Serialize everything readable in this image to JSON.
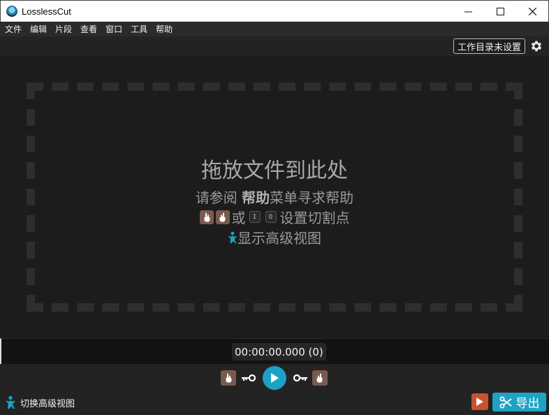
{
  "window": {
    "title": "LosslessCut",
    "controls": {
      "minimize": "minimize-icon",
      "maximize": "maximize-icon",
      "close": "close-icon"
    }
  },
  "menu": {
    "items": [
      {
        "label": "文件"
      },
      {
        "label": "编辑"
      },
      {
        "label": "片段"
      },
      {
        "label": "查看"
      },
      {
        "label": "窗口"
      },
      {
        "label": "工具"
      },
      {
        "label": "帮助"
      }
    ]
  },
  "toolbar": {
    "workdir_label": "工作目录未设置",
    "settings_icon": "gear-icon"
  },
  "dropzone": {
    "title": "拖放文件到此处",
    "help_prefix": "请参阅 ",
    "help_bold": "帮助",
    "help_suffix": "菜单寻求帮助",
    "cut_or": "或",
    "key_in": "I",
    "key_out": "O",
    "cut_suffix": "设置切割点",
    "advanced_view": "显示高级视图"
  },
  "timeline": {
    "timecode": "00:00:00.000 (0)"
  },
  "controls": {
    "advanced_toggle": "切换高级视图",
    "export_label": "导出"
  },
  "colors": {
    "accent": "#1ba3c6",
    "hand_button": "#7a5a4d",
    "export_orange": "#c9522e",
    "background": "#1c1c1c"
  }
}
